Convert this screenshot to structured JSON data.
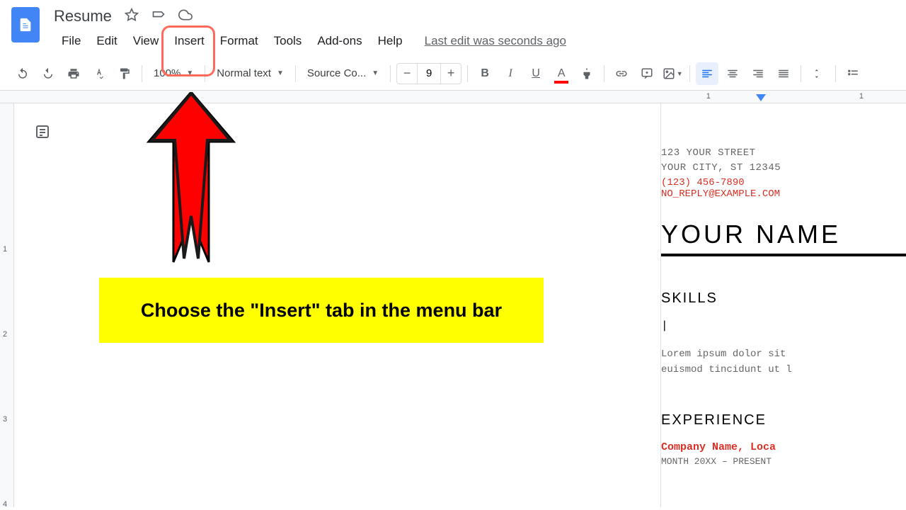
{
  "doc": {
    "title": "Resume"
  },
  "menu": {
    "file": "File",
    "edit": "Edit",
    "view": "View",
    "insert": "Insert",
    "format": "Format",
    "tools": "Tools",
    "addons": "Add-ons",
    "help": "Help",
    "last_edit": "Last edit was seconds ago"
  },
  "toolbar": {
    "zoom": "100%",
    "style": "Normal text",
    "font": "Source Co...",
    "font_size": "9"
  },
  "ruler": {
    "mark1": "1",
    "mark2": "1"
  },
  "left_ruler": {
    "m1": "1",
    "m2": "2",
    "m3": "3",
    "m4": "4"
  },
  "resume": {
    "street": "123 YOUR STREET",
    "city": "YOUR CITY, ST 12345",
    "phone": "(123) 456-7890",
    "email": "NO_REPLY@EXAMPLE.COM",
    "name": "YOUR NAME",
    "skills_title": "SKILLS",
    "cursor": "|",
    "lorem1": "Lorem ipsum dolor sit",
    "lorem2": "euismod tincidunt ut l",
    "experience_title": "EXPERIENCE",
    "company": "Company Name, Loca",
    "dates": "MONTH 20XX – PRESENT"
  },
  "callout": {
    "text": "Choose the \"Insert\" tab in the menu bar"
  }
}
